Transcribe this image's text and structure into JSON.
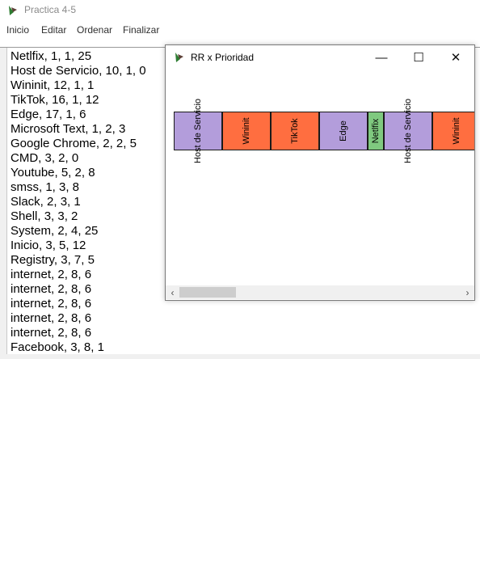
{
  "main_window": {
    "title": "Practica 4-5",
    "menu": [
      "Inicio",
      "Editar",
      "Ordenar",
      "Finalizar"
    ],
    "processes": [
      "Netlfix, 1, 1, 25",
      "Host de Servicio, 10, 1, 0",
      "Wininit, 12, 1, 1",
      "TikTok, 16, 1, 12",
      "Edge, 17, 1, 6",
      "Microsoft Text, 1, 2, 3",
      "Google Chrome, 2, 2, 5",
      "CMD, 3, 2, 0",
      "Youtube, 5, 2, 8",
      "smss, 1, 3, 8",
      "Slack, 2, 3, 1",
      "Shell, 3, 3, 2",
      "System, 2, 4, 25",
      "Inicio, 3, 5, 12",
      "Registry, 3, 7, 5",
      "internet, 2, 8, 6",
      "internet, 2, 8, 6",
      "internet, 2, 8, 6",
      "internet, 2, 8, 6",
      "internet, 2, 8, 6",
      "Facebook, 3, 8, 1"
    ]
  },
  "child_window": {
    "title": "RR x Prioridad",
    "buttons": {
      "minimize": "—",
      "maximize": "☐",
      "close": "✕"
    },
    "gantt": [
      {
        "label": "Host de Servicio",
        "color": "#b39ddb"
      },
      {
        "label": "Wininit",
        "color": "#ff6e40"
      },
      {
        "label": "TikTok",
        "color": "#ff6e40"
      },
      {
        "label": "Edge",
        "color": "#b39ddb"
      },
      {
        "label": "Netlfix",
        "color": "#7fc97f"
      },
      {
        "label": "Host de Servicio",
        "color": "#b39ddb"
      },
      {
        "label": "Wininit",
        "color": "#ff6e40"
      }
    ]
  }
}
